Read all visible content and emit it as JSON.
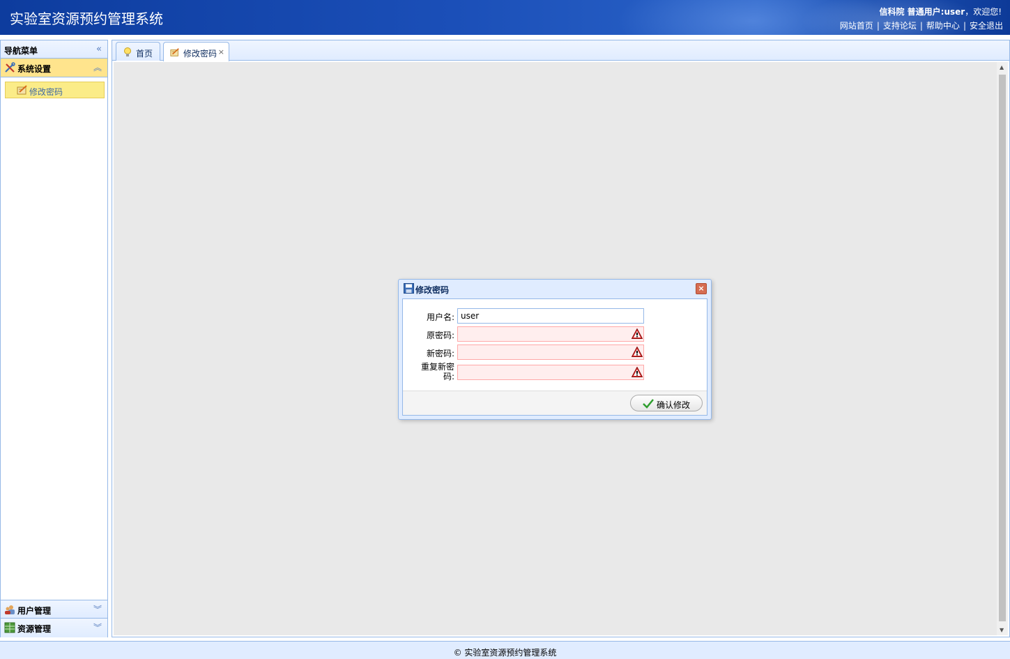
{
  "header": {
    "app_title": "实验室资源预约管理系统",
    "org": "信科院",
    "user_label": "普通用户:user",
    "welcome": "，欢迎您!",
    "links": [
      "网站首页",
      "支持论坛",
      "帮助中心",
      "安全退出"
    ]
  },
  "nav": {
    "title": "导航菜单",
    "sections": [
      {
        "label": "系统设置",
        "icon": "tools-icon",
        "expanded": true,
        "items": [
          {
            "label": "修改密码",
            "icon": "edit-icon",
            "selected": true
          }
        ]
      },
      {
        "label": "用户管理",
        "icon": "users-icon",
        "expanded": false
      },
      {
        "label": "资源管理",
        "icon": "grid-icon",
        "expanded": false
      }
    ]
  },
  "tabs": [
    {
      "label": "首页",
      "icon": "lightbulb-icon",
      "selected": false,
      "closable": false
    },
    {
      "label": "修改密码",
      "icon": "edit-icon",
      "selected": true,
      "closable": true,
      "close_glyph": "×"
    }
  ],
  "dialog": {
    "title": "修改密码",
    "icon": "save-icon",
    "fields": [
      {
        "label": "用户名:",
        "value": "user",
        "invalid": false
      },
      {
        "label": "原密码:",
        "value": "",
        "invalid": true
      },
      {
        "label": "新密码:",
        "value": "",
        "invalid": true
      },
      {
        "label": "重复新密码:",
        "value": "",
        "invalid": true
      }
    ],
    "confirm_button": "确认修改"
  },
  "footer": {
    "text": "© 实验室资源预约管理系统"
  },
  "colors": {
    "header_blue": "#1b4fb8",
    "panel_border": "#95b8e7",
    "selected_yellow": "#fbec88",
    "error_bg": "#ffeeee"
  }
}
